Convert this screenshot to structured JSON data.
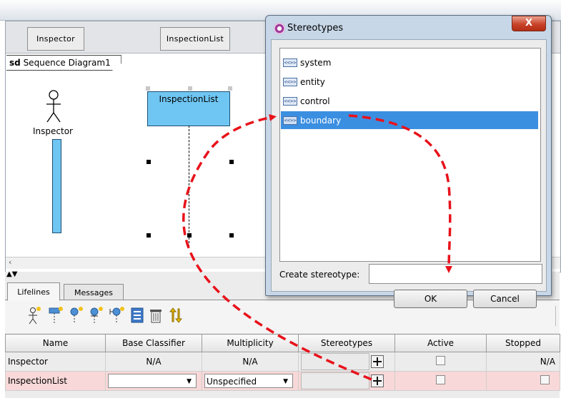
{
  "diagram": {
    "tab_inspector": "Inspector",
    "tab_inspection_list": "InspectionList",
    "frame_keyword": "sd",
    "frame_name": "Sequence Diagram1",
    "actor_name": "Inspector",
    "lifeline_name": "InspectionList"
  },
  "bottom_panel": {
    "tabs": [
      {
        "label": "Lifelines"
      },
      {
        "label": "Messages"
      }
    ],
    "toolbar_icons": [
      "add-actor-icon",
      "add-lifeline-icon",
      "add-control-icon",
      "add-entity-icon",
      "add-boundary-icon",
      "document-icon",
      "delete-icon",
      "sort-icon"
    ],
    "columns": [
      "Name",
      "Base Classifier",
      "Multiplicity",
      "Stereotypes",
      "Active",
      "Stopped"
    ],
    "rows": [
      {
        "name": "Inspector",
        "base_classifier": "N/A",
        "multiplicity": "N/A",
        "stopped": "N/A"
      },
      {
        "name": "InspectionList",
        "base_classifier": "",
        "multiplicity": "Unspecified"
      }
    ]
  },
  "dialog": {
    "title": "Stereotypes",
    "close_glyph": "X",
    "items": [
      {
        "label": "system",
        "icon_text": "<<>>"
      },
      {
        "label": "entity",
        "icon_text": "<<>>"
      },
      {
        "label": "control",
        "icon_text": "<<>>"
      },
      {
        "label": "boundary",
        "icon_text": "<<>>"
      }
    ],
    "selected_index": 3,
    "create_label": "Create stereotype:",
    "create_value": "",
    "ok_label": "OK",
    "cancel_label": "Cancel"
  },
  "colors": {
    "lifeline_fill": "#6fc6f3",
    "selection_blue": "#3b8fe1",
    "annotation_red": "#e8121b",
    "selected_row": "#f8d8d8"
  }
}
